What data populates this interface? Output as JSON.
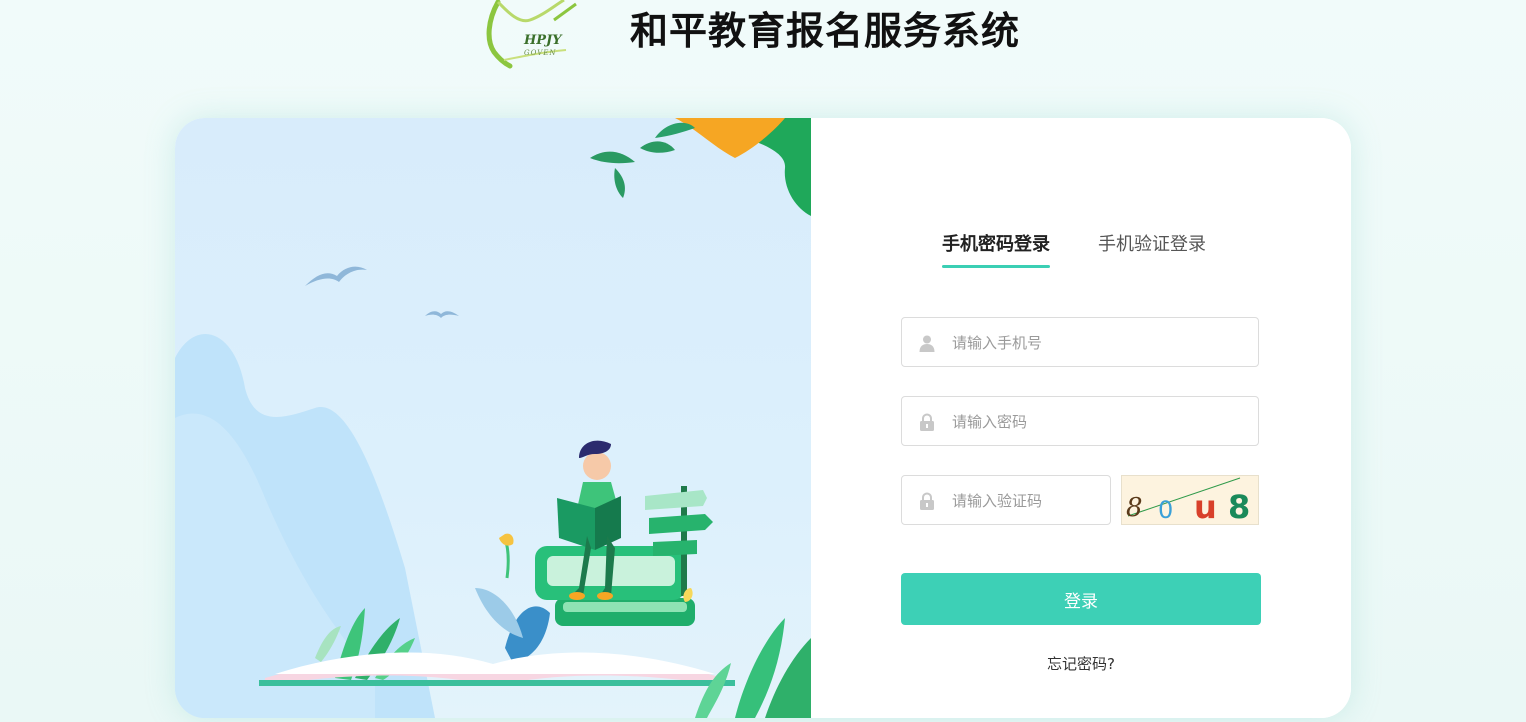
{
  "header": {
    "title": "和平教育报名服务系统",
    "logo_text": "HPJY",
    "logo_subtext": "GOVEN"
  },
  "login": {
    "tabs": [
      {
        "label": "手机密码登录",
        "active": true
      },
      {
        "label": "手机验证登录",
        "active": false
      }
    ],
    "phone_placeholder": "请输入手机号",
    "password_placeholder": "请输入密码",
    "captcha_placeholder": "请输入验证码",
    "captcha_chars": [
      "8",
      "0",
      "u",
      "8"
    ],
    "submit_label": "登录",
    "forgot_label": "忘记密码?"
  },
  "colors": {
    "accent": "#3dd0b6",
    "title": "#111111",
    "illustration_bg": "#d8ecfb"
  },
  "icons": {
    "phone_field": "user-icon",
    "password_field": "lock-icon",
    "captcha_field": "lock-icon"
  }
}
